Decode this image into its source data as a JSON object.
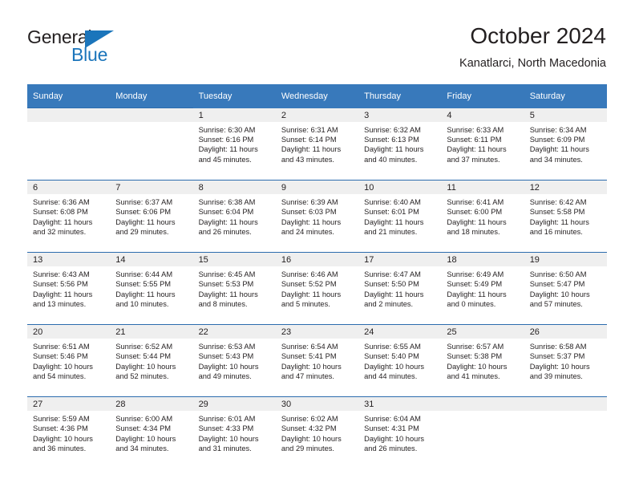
{
  "brand": {
    "name_part1": "General",
    "name_part2": "Blue",
    "logo_icon": "triangle-flag-icon"
  },
  "header": {
    "title": "October 2024",
    "location": "Kanatlarci, North Macedonia"
  },
  "theme": {
    "header_blue": "#3879bb",
    "rule_blue": "#2c6cae",
    "daynum_band": "#efefef",
    "brand_blue": "#1b75bb",
    "text": "#231f20"
  },
  "calendar": {
    "weekday_headers": [
      "Sunday",
      "Monday",
      "Tuesday",
      "Wednesday",
      "Thursday",
      "Friday",
      "Saturday"
    ],
    "weeks": [
      [
        {
          "day": "",
          "sunrise": "",
          "sunset": "",
          "daylight_1": "",
          "daylight_2": ""
        },
        {
          "day": "",
          "sunrise": "",
          "sunset": "",
          "daylight_1": "",
          "daylight_2": ""
        },
        {
          "day": "1",
          "sunrise": "Sunrise: 6:30 AM",
          "sunset": "Sunset: 6:16 PM",
          "daylight_1": "Daylight: 11 hours",
          "daylight_2": "and 45 minutes."
        },
        {
          "day": "2",
          "sunrise": "Sunrise: 6:31 AM",
          "sunset": "Sunset: 6:14 PM",
          "daylight_1": "Daylight: 11 hours",
          "daylight_2": "and 43 minutes."
        },
        {
          "day": "3",
          "sunrise": "Sunrise: 6:32 AM",
          "sunset": "Sunset: 6:13 PM",
          "daylight_1": "Daylight: 11 hours",
          "daylight_2": "and 40 minutes."
        },
        {
          "day": "4",
          "sunrise": "Sunrise: 6:33 AM",
          "sunset": "Sunset: 6:11 PM",
          "daylight_1": "Daylight: 11 hours",
          "daylight_2": "and 37 minutes."
        },
        {
          "day": "5",
          "sunrise": "Sunrise: 6:34 AM",
          "sunset": "Sunset: 6:09 PM",
          "daylight_1": "Daylight: 11 hours",
          "daylight_2": "and 34 minutes."
        }
      ],
      [
        {
          "day": "6",
          "sunrise": "Sunrise: 6:36 AM",
          "sunset": "Sunset: 6:08 PM",
          "daylight_1": "Daylight: 11 hours",
          "daylight_2": "and 32 minutes."
        },
        {
          "day": "7",
          "sunrise": "Sunrise: 6:37 AM",
          "sunset": "Sunset: 6:06 PM",
          "daylight_1": "Daylight: 11 hours",
          "daylight_2": "and 29 minutes."
        },
        {
          "day": "8",
          "sunrise": "Sunrise: 6:38 AM",
          "sunset": "Sunset: 6:04 PM",
          "daylight_1": "Daylight: 11 hours",
          "daylight_2": "and 26 minutes."
        },
        {
          "day": "9",
          "sunrise": "Sunrise: 6:39 AM",
          "sunset": "Sunset: 6:03 PM",
          "daylight_1": "Daylight: 11 hours",
          "daylight_2": "and 24 minutes."
        },
        {
          "day": "10",
          "sunrise": "Sunrise: 6:40 AM",
          "sunset": "Sunset: 6:01 PM",
          "daylight_1": "Daylight: 11 hours",
          "daylight_2": "and 21 minutes."
        },
        {
          "day": "11",
          "sunrise": "Sunrise: 6:41 AM",
          "sunset": "Sunset: 6:00 PM",
          "daylight_1": "Daylight: 11 hours",
          "daylight_2": "and 18 minutes."
        },
        {
          "day": "12",
          "sunrise": "Sunrise: 6:42 AM",
          "sunset": "Sunset: 5:58 PM",
          "daylight_1": "Daylight: 11 hours",
          "daylight_2": "and 16 minutes."
        }
      ],
      [
        {
          "day": "13",
          "sunrise": "Sunrise: 6:43 AM",
          "sunset": "Sunset: 5:56 PM",
          "daylight_1": "Daylight: 11 hours",
          "daylight_2": "and 13 minutes."
        },
        {
          "day": "14",
          "sunrise": "Sunrise: 6:44 AM",
          "sunset": "Sunset: 5:55 PM",
          "daylight_1": "Daylight: 11 hours",
          "daylight_2": "and 10 minutes."
        },
        {
          "day": "15",
          "sunrise": "Sunrise: 6:45 AM",
          "sunset": "Sunset: 5:53 PM",
          "daylight_1": "Daylight: 11 hours",
          "daylight_2": "and 8 minutes."
        },
        {
          "day": "16",
          "sunrise": "Sunrise: 6:46 AM",
          "sunset": "Sunset: 5:52 PM",
          "daylight_1": "Daylight: 11 hours",
          "daylight_2": "and 5 minutes."
        },
        {
          "day": "17",
          "sunrise": "Sunrise: 6:47 AM",
          "sunset": "Sunset: 5:50 PM",
          "daylight_1": "Daylight: 11 hours",
          "daylight_2": "and 2 minutes."
        },
        {
          "day": "18",
          "sunrise": "Sunrise: 6:49 AM",
          "sunset": "Sunset: 5:49 PM",
          "daylight_1": "Daylight: 11 hours",
          "daylight_2": "and 0 minutes."
        },
        {
          "day": "19",
          "sunrise": "Sunrise: 6:50 AM",
          "sunset": "Sunset: 5:47 PM",
          "daylight_1": "Daylight: 10 hours",
          "daylight_2": "and 57 minutes."
        }
      ],
      [
        {
          "day": "20",
          "sunrise": "Sunrise: 6:51 AM",
          "sunset": "Sunset: 5:46 PM",
          "daylight_1": "Daylight: 10 hours",
          "daylight_2": "and 54 minutes."
        },
        {
          "day": "21",
          "sunrise": "Sunrise: 6:52 AM",
          "sunset": "Sunset: 5:44 PM",
          "daylight_1": "Daylight: 10 hours",
          "daylight_2": "and 52 minutes."
        },
        {
          "day": "22",
          "sunrise": "Sunrise: 6:53 AM",
          "sunset": "Sunset: 5:43 PM",
          "daylight_1": "Daylight: 10 hours",
          "daylight_2": "and 49 minutes."
        },
        {
          "day": "23",
          "sunrise": "Sunrise: 6:54 AM",
          "sunset": "Sunset: 5:41 PM",
          "daylight_1": "Daylight: 10 hours",
          "daylight_2": "and 47 minutes."
        },
        {
          "day": "24",
          "sunrise": "Sunrise: 6:55 AM",
          "sunset": "Sunset: 5:40 PM",
          "daylight_1": "Daylight: 10 hours",
          "daylight_2": "and 44 minutes."
        },
        {
          "day": "25",
          "sunrise": "Sunrise: 6:57 AM",
          "sunset": "Sunset: 5:38 PM",
          "daylight_1": "Daylight: 10 hours",
          "daylight_2": "and 41 minutes."
        },
        {
          "day": "26",
          "sunrise": "Sunrise: 6:58 AM",
          "sunset": "Sunset: 5:37 PM",
          "daylight_1": "Daylight: 10 hours",
          "daylight_2": "and 39 minutes."
        }
      ],
      [
        {
          "day": "27",
          "sunrise": "Sunrise: 5:59 AM",
          "sunset": "Sunset: 4:36 PM",
          "daylight_1": "Daylight: 10 hours",
          "daylight_2": "and 36 minutes."
        },
        {
          "day": "28",
          "sunrise": "Sunrise: 6:00 AM",
          "sunset": "Sunset: 4:34 PM",
          "daylight_1": "Daylight: 10 hours",
          "daylight_2": "and 34 minutes."
        },
        {
          "day": "29",
          "sunrise": "Sunrise: 6:01 AM",
          "sunset": "Sunset: 4:33 PM",
          "daylight_1": "Daylight: 10 hours",
          "daylight_2": "and 31 minutes."
        },
        {
          "day": "30",
          "sunrise": "Sunrise: 6:02 AM",
          "sunset": "Sunset: 4:32 PM",
          "daylight_1": "Daylight: 10 hours",
          "daylight_2": "and 29 minutes."
        },
        {
          "day": "31",
          "sunrise": "Sunrise: 6:04 AM",
          "sunset": "Sunset: 4:31 PM",
          "daylight_1": "Daylight: 10 hours",
          "daylight_2": "and 26 minutes."
        },
        {
          "day": "",
          "sunrise": "",
          "sunset": "",
          "daylight_1": "",
          "daylight_2": ""
        },
        {
          "day": "",
          "sunrise": "",
          "sunset": "",
          "daylight_1": "",
          "daylight_2": ""
        }
      ]
    ]
  }
}
